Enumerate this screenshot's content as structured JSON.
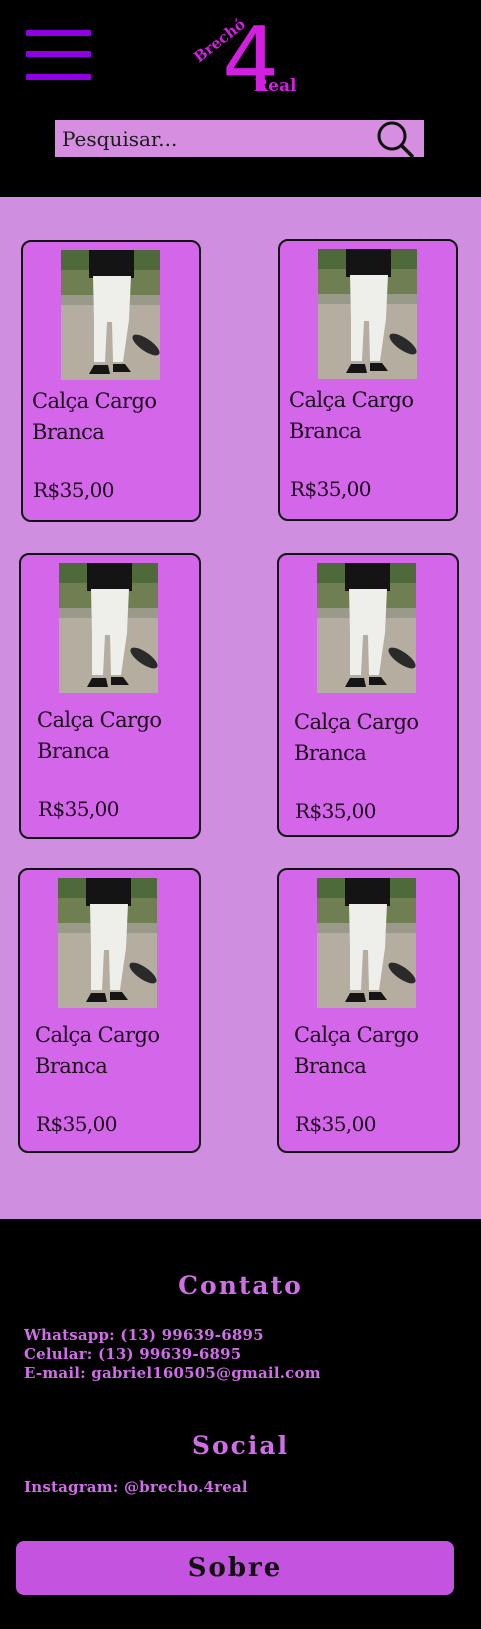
{
  "header": {
    "menu_icon": "hamburger-menu-icon",
    "logo": {
      "top_text": "Brechó",
      "number": "4",
      "bottom_text": "Real",
      "color": "#d21fe0"
    },
    "search": {
      "placeholder": "Pesquisar...",
      "icon": "search-icon"
    }
  },
  "products": [
    {
      "name": "Calça Cargo Branca",
      "price": "R$35,00"
    },
    {
      "name": "Calça Cargo Branca",
      "price": "R$35,00"
    },
    {
      "name": "Calça Cargo Branca",
      "price": "R$35,00"
    },
    {
      "name": "Calça Cargo Branca",
      "price": "R$35,00"
    },
    {
      "name": "Calça Cargo Branca",
      "price": "R$35,00"
    },
    {
      "name": "Calça Cargo Branca",
      "price": "R$35,00"
    }
  ],
  "footer": {
    "contact_title": "Contato",
    "whatsapp": "Whatsapp: (13) 99639-6895",
    "celular": "Celular: (13) 99639-6895",
    "email": "E-mail: gabriel160505@gmail.com",
    "social_title": "Social",
    "instagram": "Instagram: @brecho.4real",
    "sobre_label": "Sobre"
  },
  "colors": {
    "background": "#000000",
    "main_bg": "#cf8ee0",
    "card_bg": "#d466ea",
    "accent": "#8f00e6",
    "footer_text": "#d06ee8",
    "button_bg": "#c453e0"
  }
}
